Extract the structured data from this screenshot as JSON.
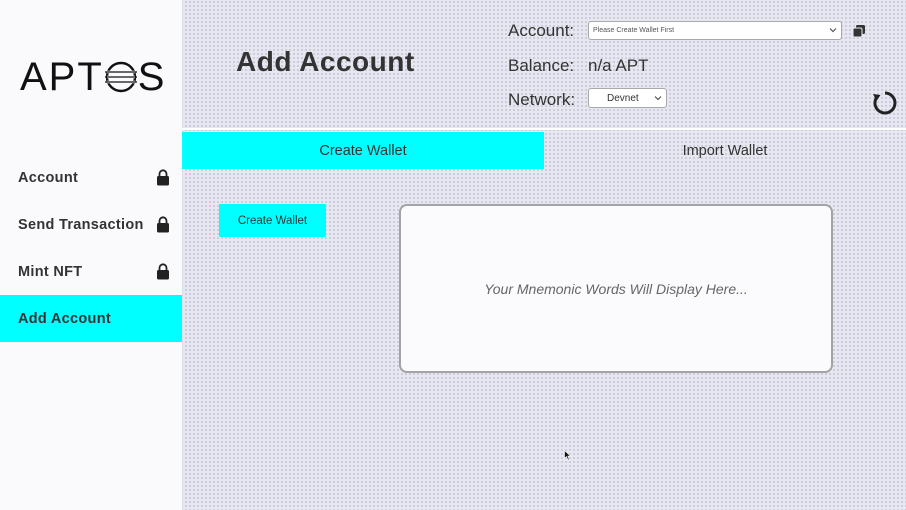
{
  "sidebar": {
    "logo": "APTOS",
    "items": [
      {
        "label": "Account",
        "locked": true,
        "active": false
      },
      {
        "label": "Send Transaction",
        "locked": true,
        "active": false
      },
      {
        "label": "Mint NFT",
        "locked": true,
        "active": false
      },
      {
        "label": "Add Account",
        "locked": false,
        "active": true
      }
    ]
  },
  "header": {
    "title": "Add Account",
    "account_label": "Account:",
    "account_select": "Please Create Wallet First",
    "balance_label": "Balance:",
    "balance_value": "n/a APT",
    "network_label": "Network:",
    "network_select": "Devnet"
  },
  "tabs": [
    {
      "label": "Create Wallet",
      "active": true
    },
    {
      "label": "Import Wallet",
      "active": false
    }
  ],
  "main": {
    "create_button": "Create Wallet",
    "mnemonic_placeholder": "Your Mnemonic Words Will Display Here..."
  },
  "icons": {
    "lock": "lock-icon",
    "copy": "copy-icon",
    "refresh": "refresh-icon",
    "chevron": "chevron-down-icon"
  },
  "colors": {
    "accent": "#00ffff",
    "text": "#333333"
  }
}
